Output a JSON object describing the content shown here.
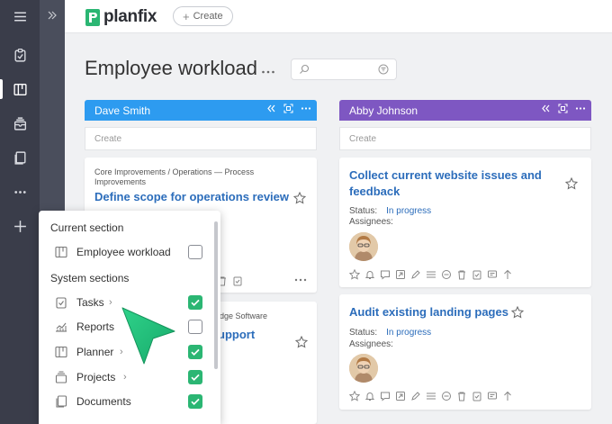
{
  "app": {
    "logo_text": "planfix",
    "create_label": "Create"
  },
  "page": {
    "title": "Employee workload",
    "search_placeholder": ""
  },
  "colors": {
    "dave": "#2d9bf0",
    "abby": "#7e57c2",
    "check": "#2bb673",
    "link": "#2c6dbb"
  },
  "columns": [
    {
      "name": "Dave Smith",
      "create_label": "Create",
      "cards": [
        {
          "breadcrumb": "Core Improvements / Operations — Process Improvements",
          "title": "Define scope for operations review"
        },
        {
          "breadcrumb_partial": "dge Software",
          "title_partial": "upport"
        }
      ]
    },
    {
      "name": "Abby Johnson",
      "create_label": "Create",
      "cards": [
        {
          "title": "Collect current website issues and feedback",
          "status_label": "Status:",
          "status": "In progress",
          "assignees_label": "Assignees:"
        },
        {
          "title": "Audit existing landing pages",
          "status_label": "Status:",
          "status": "In progress",
          "assignees_label": "Assignees:"
        }
      ]
    }
  ],
  "menu": {
    "current_heading": "Current section",
    "current_items": [
      {
        "label": "Employee workload",
        "checked": false
      }
    ],
    "system_heading": "System sections",
    "system_items": [
      {
        "label": "Tasks",
        "checked": true,
        "has_submenu": true
      },
      {
        "label": "Reports",
        "checked": false,
        "has_submenu": false
      },
      {
        "label": "Planner",
        "checked": true,
        "has_submenu": true
      },
      {
        "label": "Projects",
        "checked": true,
        "has_submenu": true
      },
      {
        "label": "Documents",
        "checked": true,
        "has_submenu": false
      }
    ]
  }
}
